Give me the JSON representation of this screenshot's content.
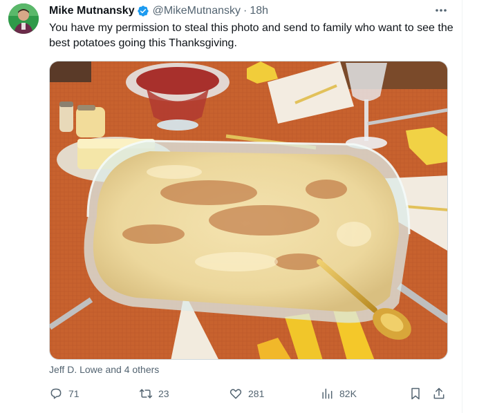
{
  "tweet": {
    "author_name": "Mike Mutnansky",
    "handle": "@MikeMutnansky",
    "separator": "·",
    "time": "18h",
    "text": "You have my permission to steal this photo and send to family who want to see the best potatoes going this Thanksgiving.",
    "verified_color": "#1d9bf0",
    "icon": "more-icon"
  },
  "liked_by": "Jeff D. Lowe and 4 others",
  "actions": {
    "replies": "71",
    "reposts": "23",
    "likes": "281",
    "views": "82K",
    "icons": [
      "reply-icon",
      "repost-icon",
      "like-icon",
      "views-icon",
      "bookmark-icon",
      "share-icon"
    ]
  },
  "colors": {
    "text_secondary": "#536471",
    "text_primary": "#0f1419"
  }
}
